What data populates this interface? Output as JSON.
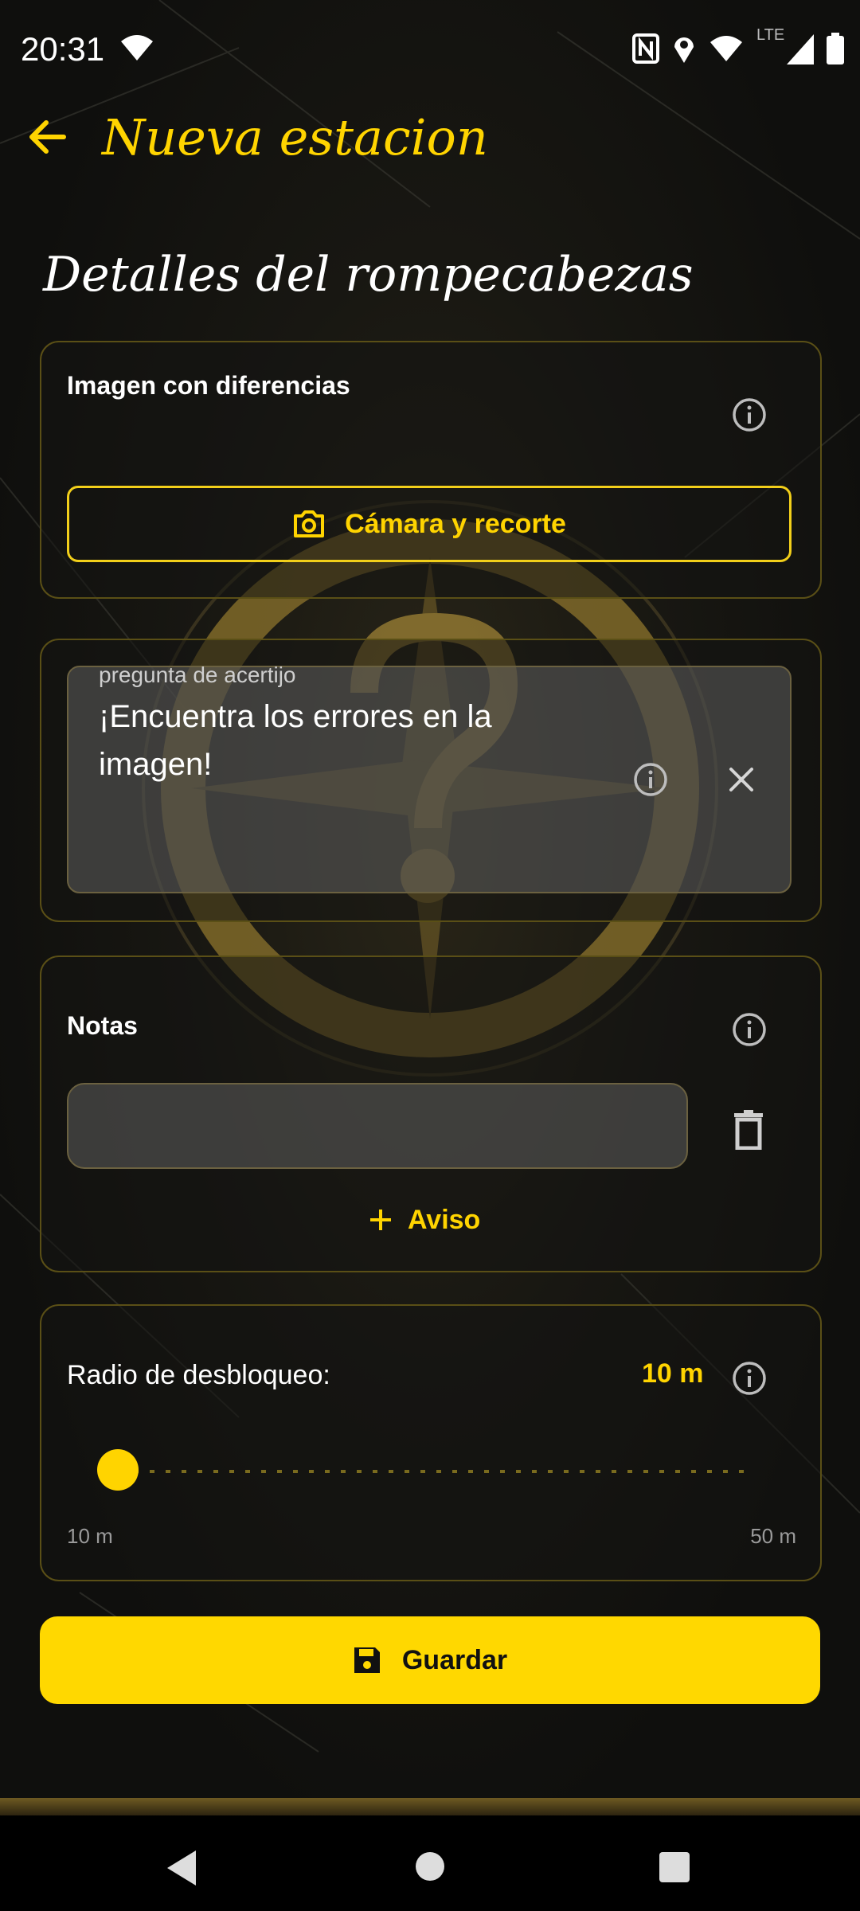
{
  "status_bar": {
    "time": "20:31",
    "network_label": "LTE",
    "icons": [
      "wifi-icon",
      "nfc-icon",
      "location-icon",
      "wifi-icon",
      "signal-icon",
      "battery-icon"
    ]
  },
  "app_bar": {
    "title": "Nueva estacion",
    "back_icon": "arrow-left-icon"
  },
  "section_title": "Detalles del rompecabezas",
  "image_card": {
    "label": "Imagen con diferencias",
    "camera_button_label": "Cámara y recorte"
  },
  "question_card": {
    "field_label": "pregunta de acertijo",
    "field_value": "¡Encuentra los errores en la imagen!"
  },
  "notes_card": {
    "label": "Notas",
    "note_value": "",
    "add_button_label": "Aviso"
  },
  "radius_card": {
    "label": "Radio de desbloqueo:",
    "current_value": "10 m",
    "min_label": "10 m",
    "max_label": "50 m",
    "slider_fraction": 0.0
  },
  "save_button_label": "Guardar",
  "colors": {
    "accent": "#ffd400",
    "background": "#121212",
    "card_border": "#5a4f16"
  }
}
